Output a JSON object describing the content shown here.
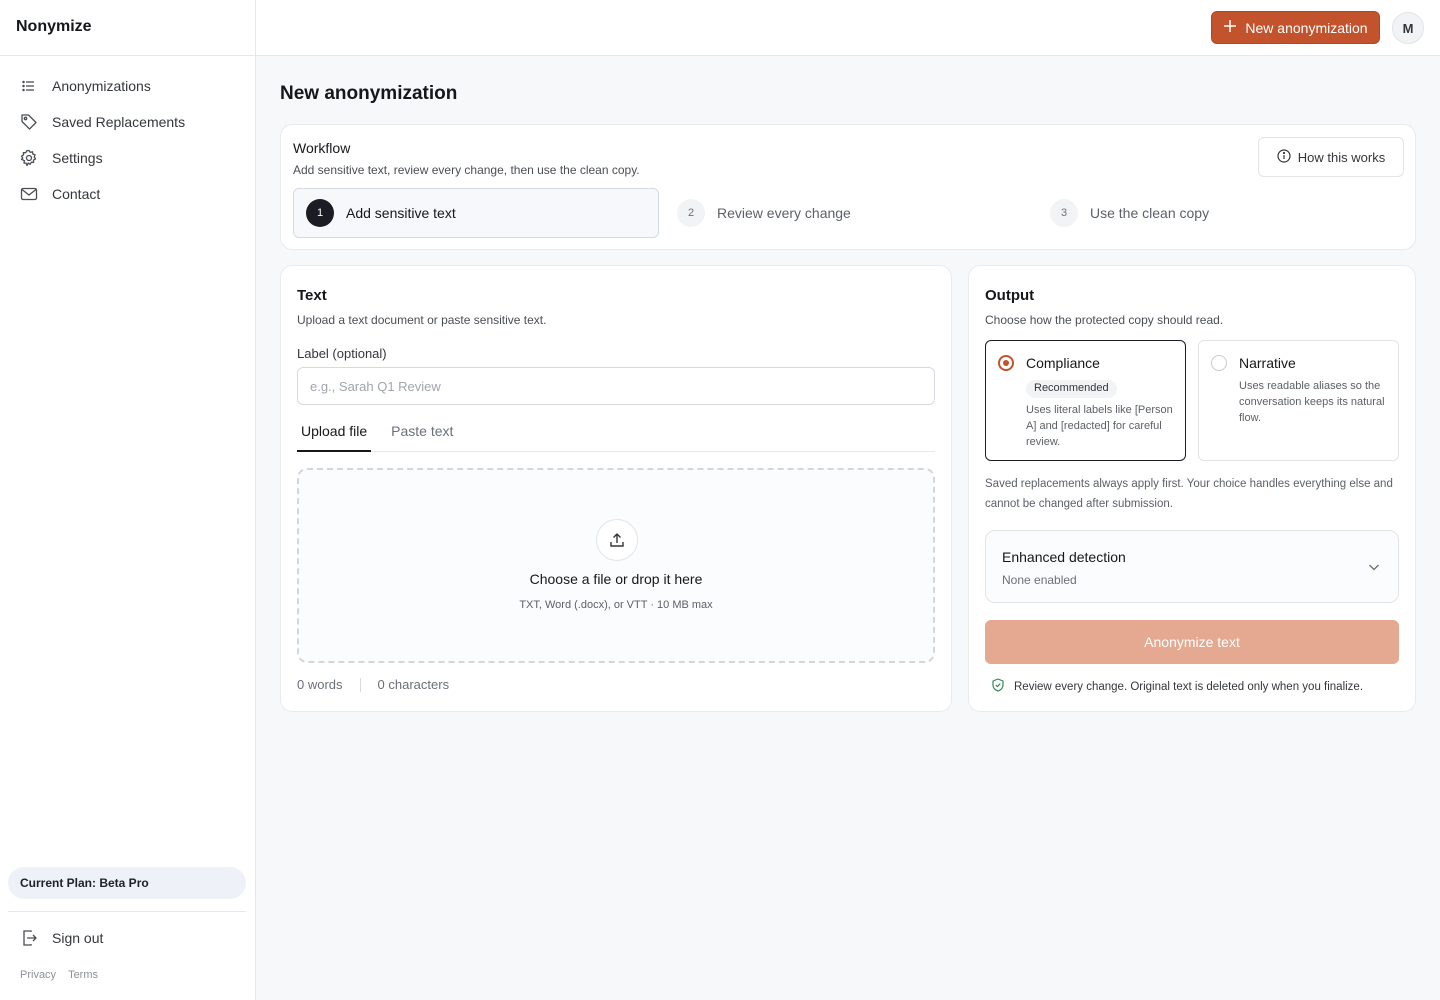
{
  "app": {
    "name": "Nonymize"
  },
  "sidebar": {
    "items": [
      {
        "label": "Anonymizations",
        "icon": "list-icon"
      },
      {
        "label": "Saved Replacements",
        "icon": "tag-icon"
      },
      {
        "label": "Settings",
        "icon": "gear-icon"
      },
      {
        "label": "Contact",
        "icon": "mail-icon"
      }
    ],
    "plan": "Current Plan: Beta Pro",
    "sign_out": "Sign out",
    "footer": {
      "privacy": "Privacy",
      "terms": "Terms"
    }
  },
  "topbar": {
    "new_button": "New anonymization",
    "avatar_initial": "M"
  },
  "page": {
    "title": "New anonymization"
  },
  "workflow": {
    "title": "Workflow",
    "subtitle": "Add sensitive text, review every change, then use the clean copy.",
    "how_button": "How this works",
    "steps": [
      {
        "num": "1",
        "label": "Add sensitive text",
        "active": true
      },
      {
        "num": "2",
        "label": "Review every change",
        "active": false
      },
      {
        "num": "3",
        "label": "Use the clean copy",
        "active": false
      }
    ]
  },
  "text_card": {
    "title": "Text",
    "subtitle": "Upload a text document or paste sensitive text.",
    "label_field": {
      "label": "Label (optional)",
      "placeholder": "e.g., Sarah Q1 Review",
      "value": ""
    },
    "tabs": [
      {
        "label": "Upload file",
        "active": true
      },
      {
        "label": "Paste text",
        "active": false
      }
    ],
    "dropzone": {
      "title": "Choose a file or drop it here",
      "subtitle": "TXT, Word (.docx), or VTT · 10 MB max"
    },
    "counts": {
      "words": "0 words",
      "characters": "0 characters"
    }
  },
  "output_card": {
    "title": "Output",
    "subtitle": "Choose how the protected copy should read.",
    "options": [
      {
        "name": "Compliance",
        "badge": "Recommended",
        "description": "Uses literal labels like [Person A] and [redacted] for careful review.",
        "selected": true
      },
      {
        "name": "Narrative",
        "badge": "",
        "description": "Uses readable aliases so the conversation keeps its natural flow.",
        "selected": false
      }
    ],
    "note": "Saved replacements always apply first. Your choice handles everything else and cannot be changed after submission.",
    "enhanced": {
      "title": "Enhanced detection",
      "status": "None enabled"
    },
    "submit_button": "Anonymize text",
    "review_note": "Review every change. Original text is deleted only when you finalize."
  },
  "colors": {
    "accent": "#c2532c",
    "accent_disabled": "#e4a990"
  }
}
